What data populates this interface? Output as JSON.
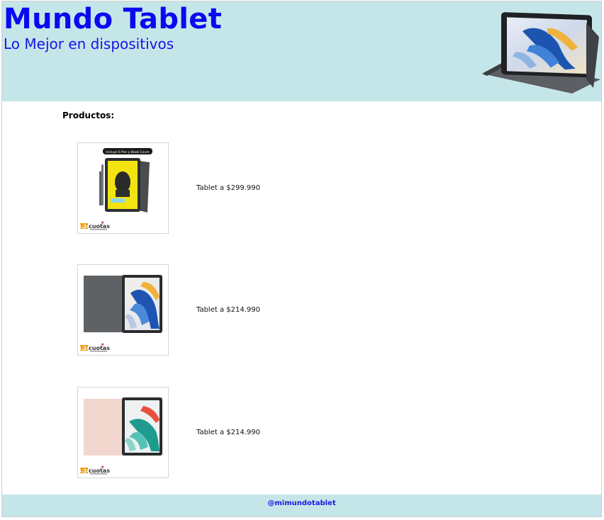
{
  "header": {
    "title": "Mundo Tablet",
    "subtitle": "Lo Mejor en dispositivos",
    "background_color": "#c5e6e8",
    "title_color": "#0a0af0",
    "hero_image_icon": "tablet-on-stand-image"
  },
  "main": {
    "section_label": "Productos:",
    "products": [
      {
        "caption": "Tablet a $299.990",
        "badge_text": "Incluye S Pen y Book Cover",
        "promo_number": "4.24",
        "promo_word": "cuotas",
        "image_icon": "tablet-book-cover-yellow-screen"
      },
      {
        "caption": "Tablet a $214.990",
        "promo_number": "4.24",
        "promo_word": "cuotas",
        "image_icon": "tablet-gray-book-cover"
      },
      {
        "caption": "Tablet a $214.990",
        "promo_number": "4.24",
        "promo_word": "cuotas",
        "image_icon": "tablet-pink-book-cover"
      }
    ]
  },
  "footer": {
    "handle": "@mimundotablet",
    "link_color": "#1a1adf"
  },
  "colors": {
    "promo_orange": "#f0a020",
    "promo_text": "#333333"
  }
}
